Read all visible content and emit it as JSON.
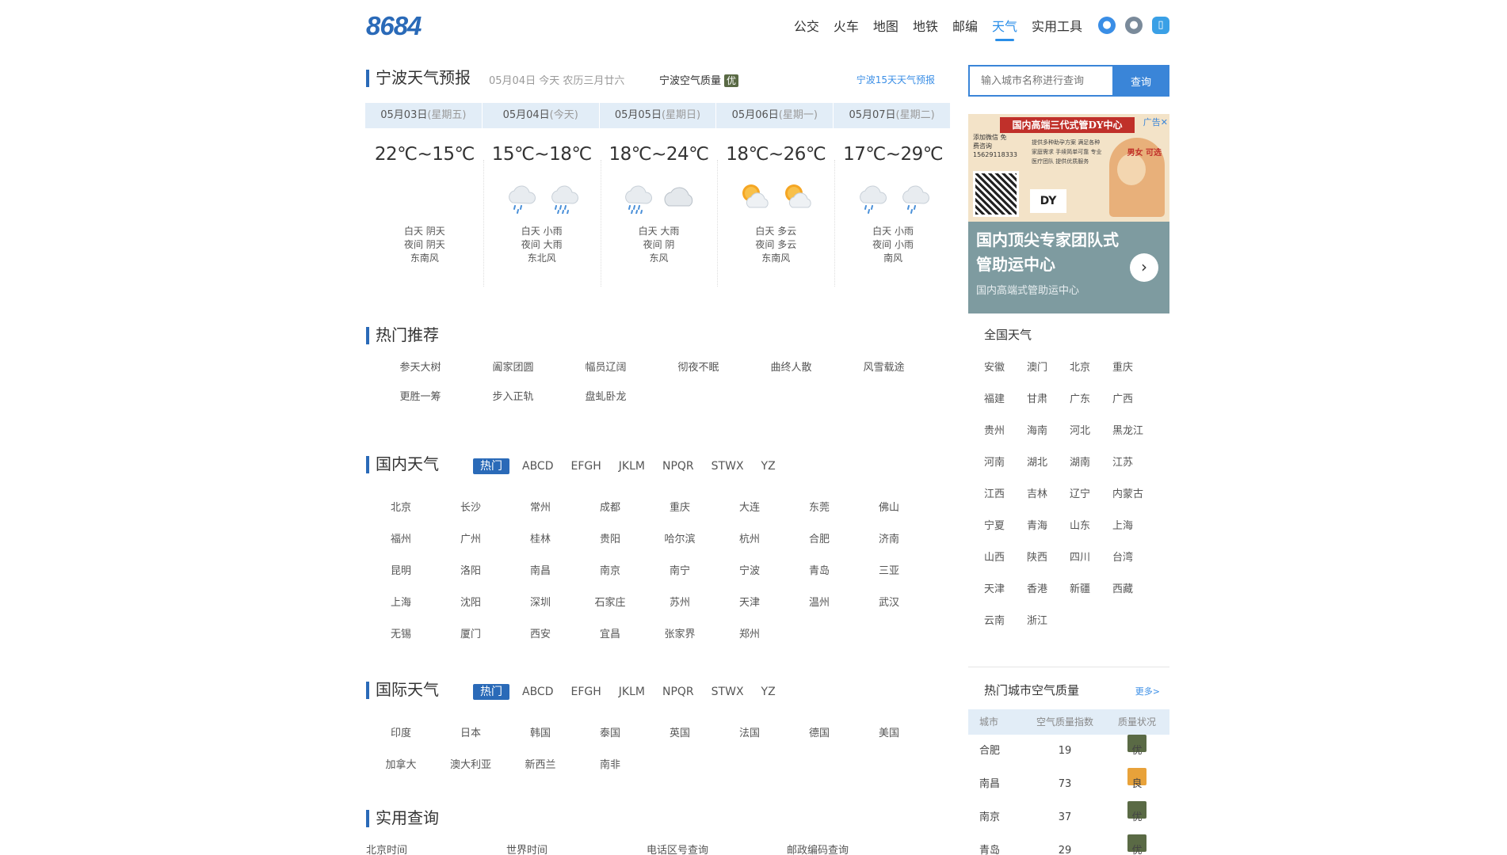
{
  "header": {
    "logo": "8684",
    "nav": [
      "公交",
      "火车",
      "地图",
      "地铁",
      "邮编",
      "天气",
      "实用工具"
    ],
    "active_nav": "天气"
  },
  "forecast": {
    "title": "宁波天气预报",
    "date_sub": "05月04日 今天 农历三月廿六",
    "aq_label": "宁波空气质量",
    "aq_level": "优",
    "link_15day": "宁波15天天气预报",
    "days": [
      {
        "date": "05月03日",
        "week": "(星期五)",
        "temp": "22℃~15℃",
        "day": "白天 阴天",
        "night": "夜间 阴天",
        "wind": "东南风",
        "icons": []
      },
      {
        "date": "05月04日",
        "week": "(今天)",
        "temp": "15℃~18℃",
        "day": "白天 小雨",
        "night": "夜间 大雨",
        "wind": "东北风",
        "icons": [
          "light-rain",
          "heavy-rain"
        ]
      },
      {
        "date": "05月05日",
        "week": "(星期日)",
        "temp": "18℃~24℃",
        "day": "白天 大雨",
        "night": "夜间 阴",
        "wind": "东风",
        "icons": [
          "heavy-rain",
          "overcast"
        ]
      },
      {
        "date": "05月06日",
        "week": "(星期一)",
        "temp": "18℃~26℃",
        "day": "白天 多云",
        "night": "夜间 多云",
        "wind": "东南风",
        "icons": [
          "partly-cloudy",
          "partly-cloudy"
        ]
      },
      {
        "date": "05月07日",
        "week": "(星期二)",
        "temp": "17℃~29℃",
        "day": "白天 小雨",
        "night": "夜间 小雨",
        "wind": "南风",
        "icons": [
          "light-rain",
          "light-rain"
        ]
      }
    ]
  },
  "hot": {
    "title": "热门推荐",
    "items": [
      "参天大树",
      "阖家团圆",
      "幅员辽阔",
      "彻夜不眠",
      "曲终人散",
      "风雪载途",
      "更胜一筹",
      "步入正轨",
      "盘虬卧龙"
    ]
  },
  "domestic": {
    "title": "国内天气",
    "tabs": [
      "热门",
      "ABCD",
      "EFGH",
      "JKLM",
      "NPQR",
      "STWX",
      "YZ"
    ],
    "cities": [
      "北京",
      "长沙",
      "常州",
      "成都",
      "重庆",
      "大连",
      "东莞",
      "佛山",
      "福州",
      "广州",
      "桂林",
      "贵阳",
      "哈尔滨",
      "杭州",
      "合肥",
      "济南",
      "昆明",
      "洛阳",
      "南昌",
      "南京",
      "南宁",
      "宁波",
      "青岛",
      "三亚",
      "上海",
      "沈阳",
      "深圳",
      "石家庄",
      "苏州",
      "天津",
      "温州",
      "武汉",
      "无锡",
      "厦门",
      "西安",
      "宜昌",
      "张家界",
      "郑州"
    ]
  },
  "intl": {
    "title": "国际天气",
    "tabs": [
      "热门",
      "ABCD",
      "EFGH",
      "JKLM",
      "NPQR",
      "STWX",
      "YZ"
    ],
    "countries": [
      "印度",
      "日本",
      "韩国",
      "泰国",
      "英国",
      "法国",
      "德国",
      "美国",
      "加拿大",
      "澳大利亚",
      "新西兰",
      "南非"
    ]
  },
  "tools": {
    "title": "实用查询",
    "items": [
      "北京时间",
      "世界时间",
      "电话区号查询",
      "邮政编码查询"
    ]
  },
  "search": {
    "placeholder": "输入城市名称进行查询",
    "button": "查询"
  },
  "ad": {
    "banner": "国内高端三代式管DY中心",
    "close": "广告✕",
    "side_text": "添加微信 免费咨询 15629118333",
    "mid_text": "提供多种助孕方案 满足各种家庭需求 手续简单可靠 专业医疗团队 提供优质服务",
    "dy": "DY",
    "red_text": "男女 可选",
    "title": "国内顶尖专家团队式管助运中心",
    "sub": "国内高端式管助运中心"
  },
  "national": {
    "title": "全国天气",
    "provinces": [
      "安徽",
      "澳门",
      "北京",
      "重庆",
      "福建",
      "甘肃",
      "广东",
      "广西",
      "贵州",
      "海南",
      "河北",
      "黑龙江",
      "河南",
      "湖北",
      "湖南",
      "江苏",
      "江西",
      "吉林",
      "辽宁",
      "内蒙古",
      "宁夏",
      "青海",
      "山东",
      "上海",
      "山西",
      "陕西",
      "四川",
      "台湾",
      "天津",
      "香港",
      "新疆",
      "西藏",
      "云南",
      "浙江"
    ]
  },
  "airq": {
    "title": "热门城市空气质量",
    "more": "更多>",
    "headers": [
      "城市",
      "空气质量指数",
      "质量状况"
    ],
    "rows": [
      {
        "city": "合肥",
        "index": "19",
        "level": "优",
        "color": "#5a6a45"
      },
      {
        "city": "南昌",
        "index": "73",
        "level": "良",
        "color": "#e8a23a"
      },
      {
        "city": "南京",
        "index": "37",
        "level": "优",
        "color": "#5a6a45"
      },
      {
        "city": "青岛",
        "index": "29",
        "level": "优",
        "color": "#5a6a45"
      }
    ]
  }
}
